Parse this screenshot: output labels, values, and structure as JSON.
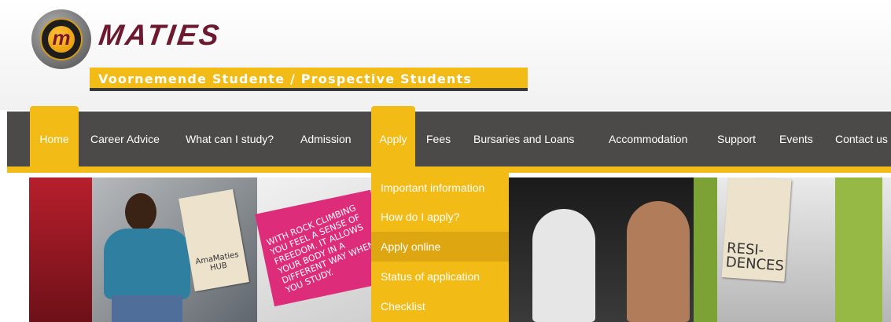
{
  "header": {
    "logo_letter": "m",
    "brand": "MATIES",
    "subtitle": "Voornemende Studente / Prospective Students"
  },
  "colors": {
    "accent": "#f3bb16",
    "nav_bg": "#4b4a48",
    "brand": "#6d1a30"
  },
  "nav": {
    "items": [
      {
        "label": "Home",
        "state": "active"
      },
      {
        "label": "Career Advice"
      },
      {
        "label": "What can I study?"
      },
      {
        "label": "Admission"
      },
      {
        "label": "Apply",
        "state": "open"
      },
      {
        "label": "Fees"
      },
      {
        "label": "Bursaries and Loans"
      },
      {
        "label": "Accommodation"
      },
      {
        "label": "Support"
      },
      {
        "label": "Events"
      },
      {
        "label": "Contact us"
      }
    ]
  },
  "apply_menu": {
    "items": [
      {
        "label": "Important information"
      },
      {
        "label": "How do I apply?"
      },
      {
        "label": "Apply online",
        "state": "hover"
      },
      {
        "label": "Status of application"
      },
      {
        "label": "Checklist"
      }
    ]
  },
  "banner": {
    "tag1": "AmaMaties HUB",
    "climb_text": "WITH ROCK CLIMBING YOU FEEL A SENSE OF FREEDOM. IT ALLOWS YOUR BODY IN A DIFFERENT WAY WHEN YOU STUDY.",
    "tag4": "RESI-DENCES"
  }
}
